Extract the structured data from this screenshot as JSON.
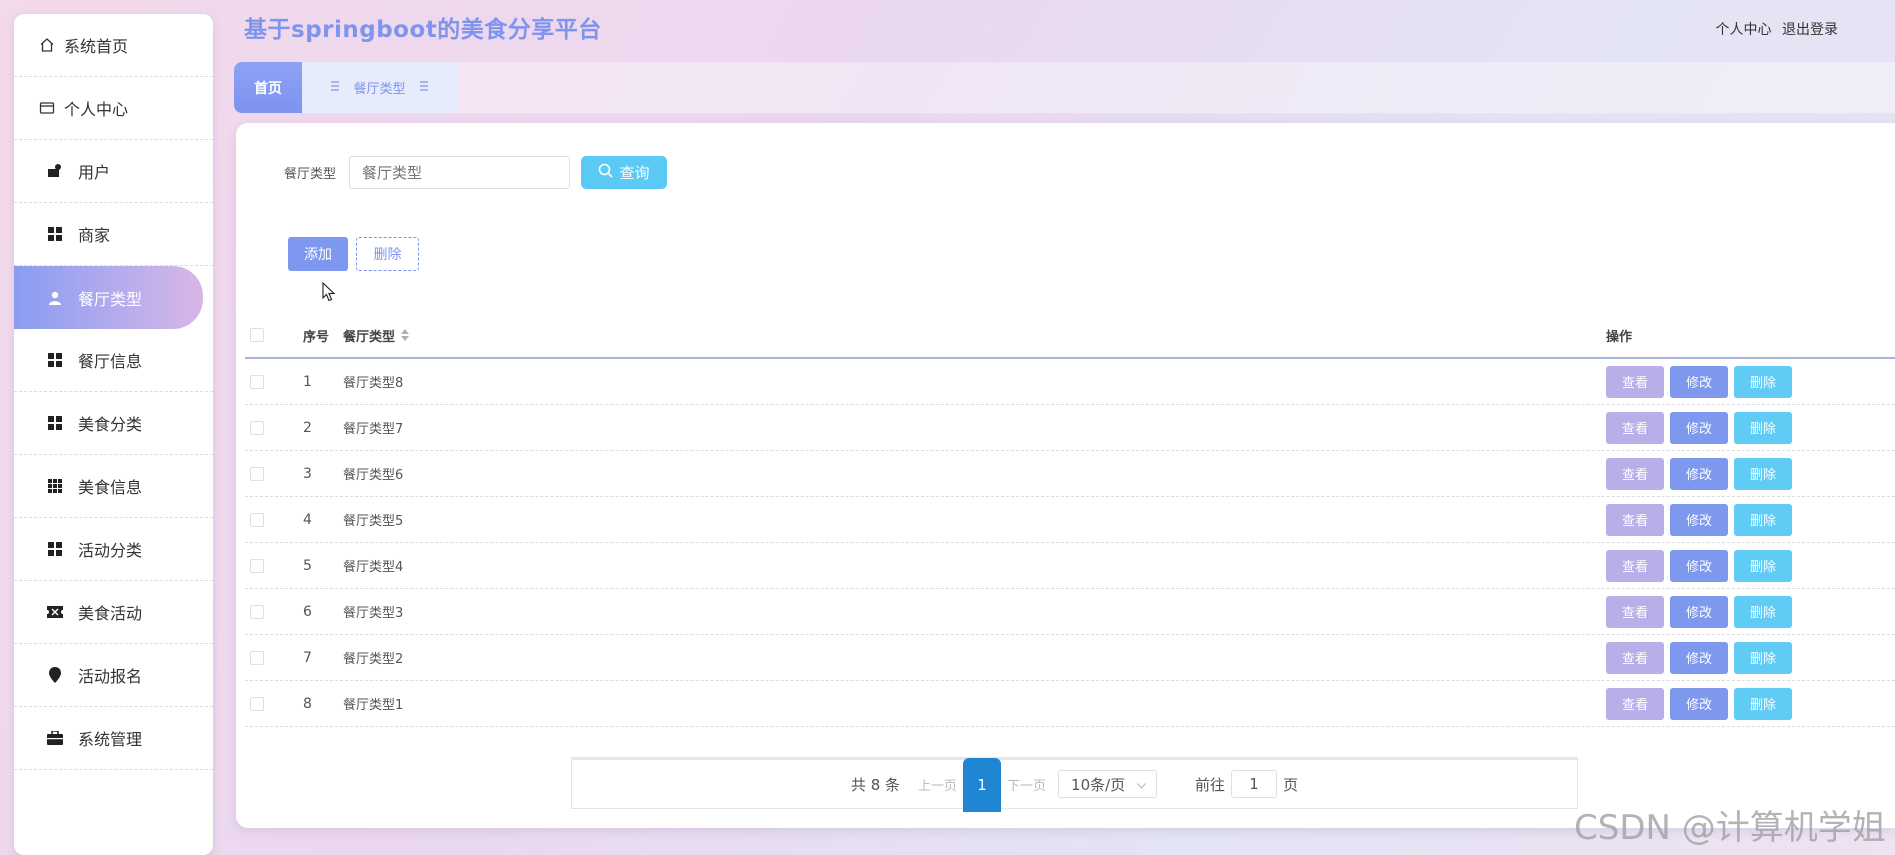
{
  "app": {
    "title": "基于springboot的美食分享平台"
  },
  "header": {
    "personal_center": "个人中心",
    "logout": "退出登录"
  },
  "sidebar": {
    "items": [
      {
        "label": "系统首页",
        "icon": "home-icon"
      },
      {
        "label": "个人中心",
        "icon": "wallet-icon"
      },
      {
        "label": "用户",
        "icon": "user-card-icon"
      },
      {
        "label": "商家",
        "icon": "grid-icon"
      },
      {
        "label": "餐厅类型",
        "icon": "person-icon",
        "active": true
      },
      {
        "label": "餐厅信息",
        "icon": "grid-icon"
      },
      {
        "label": "美食分类",
        "icon": "grid-icon"
      },
      {
        "label": "美食信息",
        "icon": "grid9-icon"
      },
      {
        "label": "活动分类",
        "icon": "grid-icon"
      },
      {
        "label": "美食活动",
        "icon": "ticket-icon"
      },
      {
        "label": "活动报名",
        "icon": "pin-icon"
      },
      {
        "label": "系统管理",
        "icon": "briefcase-icon"
      }
    ]
  },
  "tabs": {
    "home": "首页",
    "current": "餐厅类型"
  },
  "search": {
    "label": "餐厅类型",
    "placeholder": "餐厅类型",
    "button": "查询"
  },
  "toolbar": {
    "add": "添加",
    "delete": "删除"
  },
  "table": {
    "headers": {
      "index": "序号",
      "name": "餐厅类型",
      "ops": "操作"
    },
    "rows": [
      {
        "index": "1",
        "name": "餐厅类型8"
      },
      {
        "index": "2",
        "name": "餐厅类型7"
      },
      {
        "index": "3",
        "name": "餐厅类型6"
      },
      {
        "index": "4",
        "name": "餐厅类型5"
      },
      {
        "index": "5",
        "name": "餐厅类型4"
      },
      {
        "index": "6",
        "name": "餐厅类型3"
      },
      {
        "index": "7",
        "name": "餐厅类型2"
      },
      {
        "index": "8",
        "name": "餐厅类型1"
      }
    ],
    "ops": {
      "view": "查看",
      "edit": "修改",
      "delete": "删除"
    }
  },
  "pagination": {
    "total": "共 8 条",
    "prev": "上一页",
    "current": "1",
    "next": "下一页",
    "page_size": "10条/页",
    "goto_label": "前往",
    "goto_value": "1",
    "page_suffix": "页"
  },
  "watermark": "CSDN @计算机学姐",
  "colors": {
    "accent": "#7f94ec",
    "search_button": "#5bcaf5",
    "view_button": "#b9aee8",
    "edit_button": "#7e98ee",
    "delete_button": "#60ccf6",
    "pager_active": "#1f86d4"
  }
}
